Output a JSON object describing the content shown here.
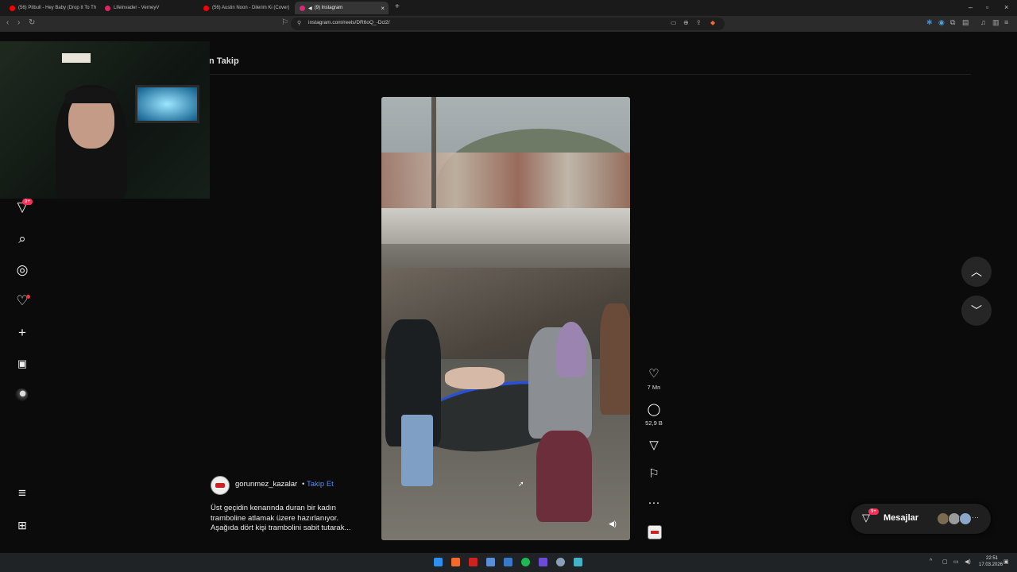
{
  "browser": {
    "tabs": [
      {
        "label": "(56) Pitbull - Hey Baby (Drop It To Th",
        "color": "#ff0000"
      },
      {
        "label": "Lifeinvader - VerneyV",
        "color": "#e0245e"
      },
      {
        "label": "(56) Austin Noon - Dilerim Ki (Cover)",
        "color": "#ff0000"
      },
      {
        "label": "(9) Instagram",
        "color": "#d62976"
      }
    ],
    "url": "instagram.com/reels/DR6oQ_-Dcl2/"
  },
  "header": {
    "follow_label": "n  Takip"
  },
  "sidebar": {
    "notifications_badge": "9+"
  },
  "post": {
    "author": "gorunmez_kazalar",
    "separator": "•",
    "follow_button": "Takip Et",
    "caption_lines": [
      "Üst geçidin kenarında duran bir kadın",
      "tramboline atlamak üzere hazırlanıyor.",
      "Aşağıda dört kişi trambolini sabit tutarak..."
    ]
  },
  "actions": {
    "likes": "7 Mn",
    "comments": "52,9 B"
  },
  "messages": {
    "label": "Mesajlar",
    "badge": "9+"
  },
  "taskbar": {
    "time": "22:51",
    "date": "17.03.2026"
  },
  "colors": {
    "accent_link": "#4f8cf5",
    "badge": "#ff2d55",
    "page_bg": "#0b0b0b"
  }
}
